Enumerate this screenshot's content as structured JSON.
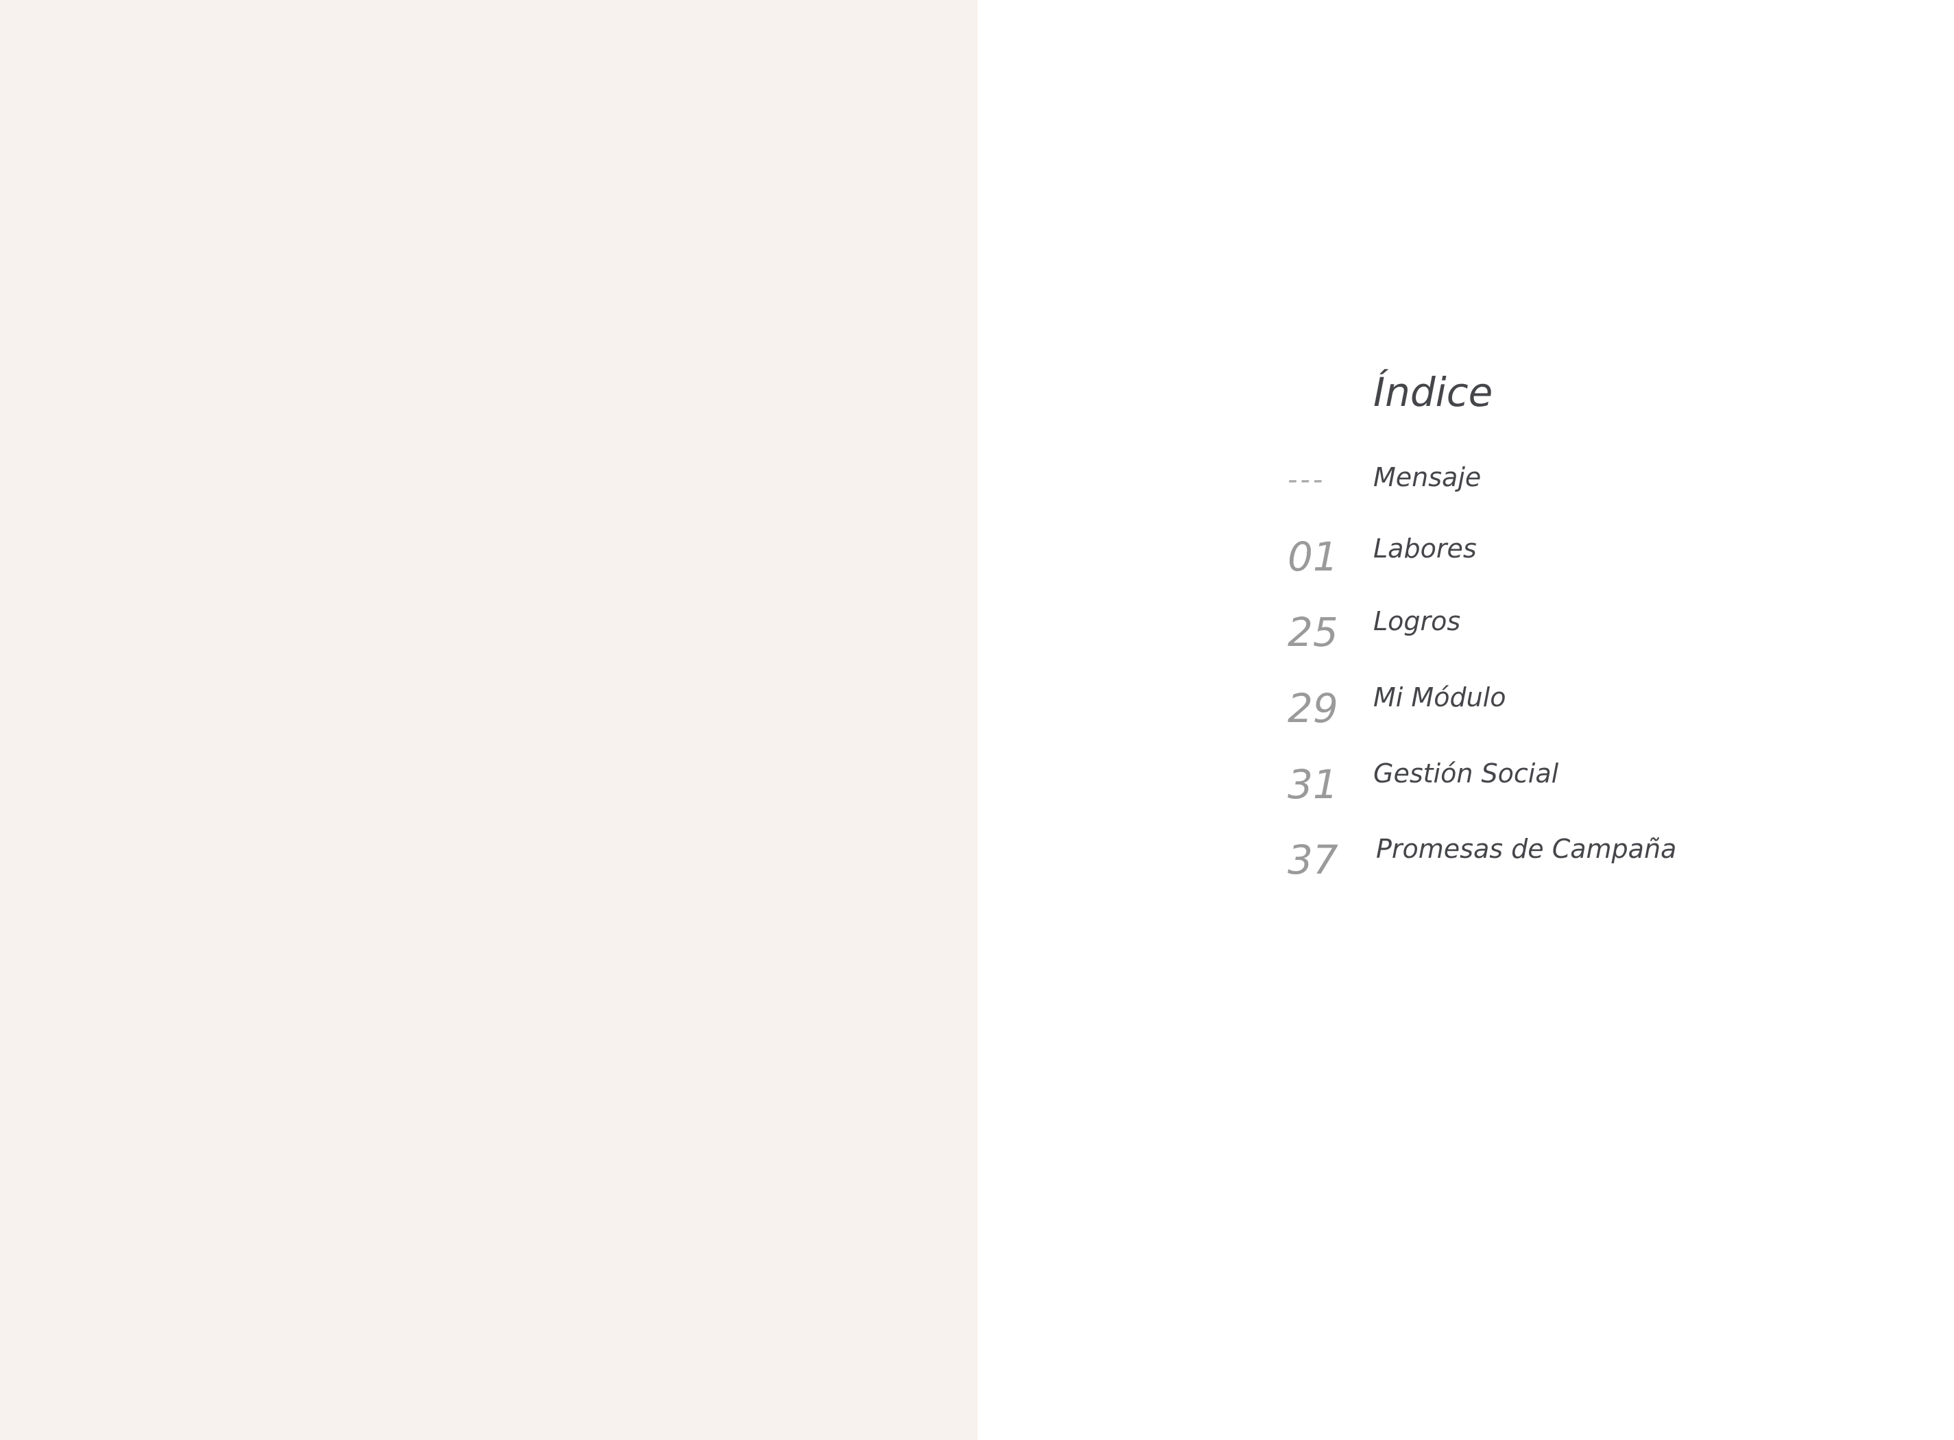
{
  "index": {
    "title": "Índice",
    "entries": [
      {
        "number": "---",
        "label": "Mensaje"
      },
      {
        "number": "01",
        "label": "Labores"
      },
      {
        "number": "25",
        "label": "Logros"
      },
      {
        "number": "29",
        "label": "Mi Módulo"
      },
      {
        "number": "31",
        "label": "Gestión Social"
      },
      {
        "number": "37",
        "label": "Promesas de Campaña"
      }
    ]
  },
  "colors": {
    "left_panel_background": "#f7f2ee",
    "right_panel_background": "#ffffff",
    "heading_text": "#45464a",
    "number_text": "#9a9a9a"
  }
}
